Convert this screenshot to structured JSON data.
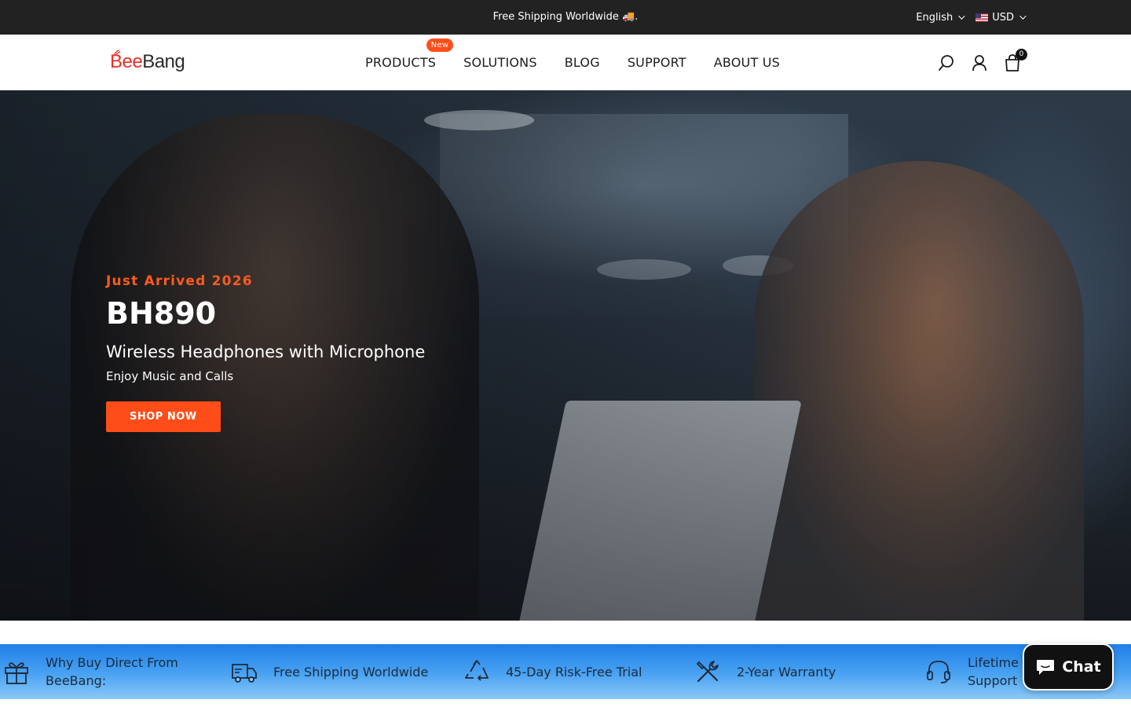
{
  "announcement": {
    "text": "Free Shipping Worldwide 🚚."
  },
  "locale": {
    "language": "English",
    "currency": "USD"
  },
  "header": {
    "logo_part1": "Bee",
    "logo_part2": "Bang",
    "nav": [
      {
        "label": "PRODUCTS",
        "badge": "New"
      },
      {
        "label": "SOLUTIONS"
      },
      {
        "label": "BLOG"
      },
      {
        "label": "SUPPORT"
      },
      {
        "label": "ABOUT US"
      }
    ],
    "cart_count": "0"
  },
  "hero": {
    "eyebrow": "Just Arrived 2026",
    "title": "BH890",
    "subtitle": "Wireless Headphones with Microphone",
    "tagline": "Enjoy Music and Calls",
    "cta_label": "SHOP NOW"
  },
  "trust": {
    "items": [
      {
        "label_line1": "Why Buy Direct From",
        "label_line2": "BeeBang:",
        "icon": "gift-icon"
      },
      {
        "label_line1": "Free Shipping Worldwide",
        "label_line2": "",
        "icon": "truck-icon"
      },
      {
        "label_line1": "45-Day Risk-Free Trial",
        "label_line2": "",
        "icon": "recycle-icon"
      },
      {
        "label_line1": "2-Year Warranty",
        "label_line2": "",
        "icon": "tools-icon"
      },
      {
        "label_line1": "Lifetime Customer",
        "label_line2": "Support",
        "icon": "headset-icon"
      }
    ]
  },
  "chat": {
    "label": "Chat"
  },
  "colors": {
    "accent": "#ff4d1a",
    "topbar": "#222222",
    "trust_top": "#1f7fe8",
    "trust_bottom": "#8cc8f7"
  }
}
